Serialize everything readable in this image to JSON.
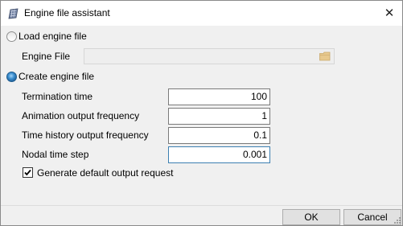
{
  "window": {
    "title": "Engine file assistant",
    "close_glyph": "✕"
  },
  "load_option": {
    "label": "Load engine file",
    "selected": false,
    "engine_file_label": "Engine File",
    "engine_file_value": "",
    "browse_icon": "folder-icon"
  },
  "create_option": {
    "label": "Create engine file",
    "selected": true
  },
  "fields": [
    {
      "label": "Termination time",
      "value": "100"
    },
    {
      "label": "Animation output frequency",
      "value": "1"
    },
    {
      "label": "Time history output frequency",
      "value": "0.1"
    },
    {
      "label": "Nodal time step",
      "value": "0.001"
    }
  ],
  "default_output": {
    "label": "Generate default output request",
    "checked": true
  },
  "buttons": {
    "ok": "OK",
    "cancel": "Cancel"
  }
}
